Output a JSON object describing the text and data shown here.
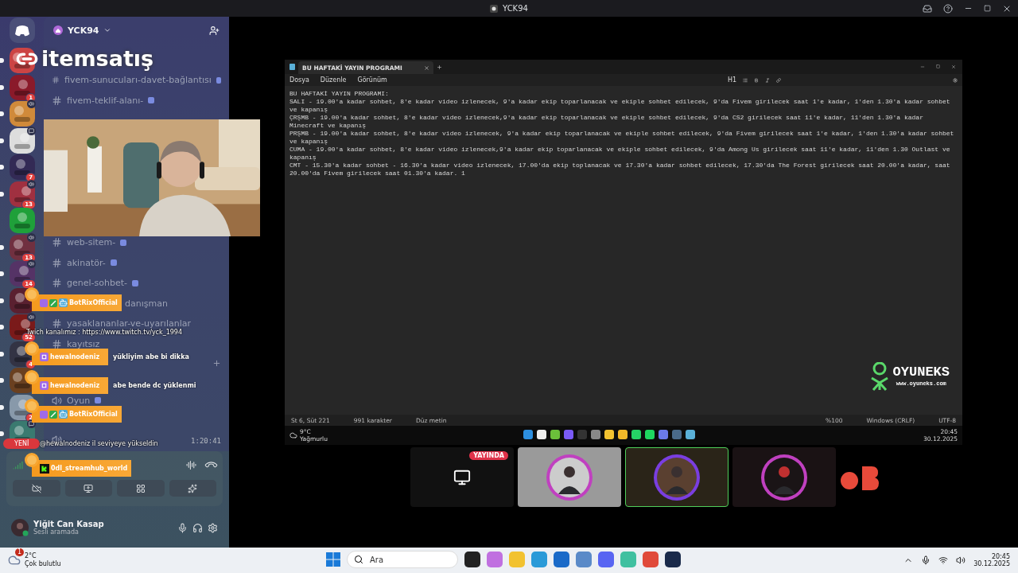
{
  "title_bar": {
    "title": "YCK94"
  },
  "servers": [
    {
      "unread": true,
      "voice": false,
      "chat": false
    },
    {
      "unread": true,
      "voice": false,
      "chat": false,
      "badge": "1"
    },
    {
      "unread": true,
      "voice": true,
      "chat": false
    },
    {
      "unread": true,
      "voice": false,
      "chat": true
    },
    {
      "unread": true,
      "voice": false,
      "chat": false,
      "badge": "7"
    },
    {
      "unread": true,
      "voice": true,
      "chat": false,
      "badge": "13"
    },
    {
      "unread": false,
      "voice": false,
      "chat": false
    },
    {
      "unread": true,
      "voice": true,
      "chat": false,
      "badge": "13"
    },
    {
      "unread": true,
      "voice": true,
      "chat": false,
      "badge": "14"
    },
    {
      "unread": true,
      "voice": false,
      "chat": false
    },
    {
      "unread": true,
      "voice": true,
      "chat": false,
      "badge": "52"
    },
    {
      "unread": true,
      "voice": false,
      "chat": false,
      "badge": "4"
    },
    {
      "unread": true,
      "voice": false,
      "chat": false
    },
    {
      "unread": true,
      "voice": false,
      "chat": false,
      "badge": "2"
    },
    {
      "unread": true,
      "voice": false,
      "chat": true
    }
  ],
  "new_pill": "YENİ",
  "sidebar": {
    "server_name": "YCK94",
    "channels_top": [
      {
        "kind": "text",
        "name": "fivem-sunucuları-davet-bağlantısı",
        "emoji": true
      },
      {
        "kind": "text",
        "name": "fivem-teklif-alanı-",
        "emoji": true
      }
    ],
    "channels": [
      {
        "kind": "text",
        "name": "web-sitem-",
        "emoji": true
      },
      {
        "kind": "text",
        "name": "akinatör-",
        "emoji": true
      },
      {
        "kind": "text",
        "name": "genel-sohbet-",
        "emoji": true
      },
      {
        "kind": "text",
        "name": "danışman",
        "emoji": false
      },
      {
        "kind": "text",
        "name": "yasaklananlar-ve-uyarılanlar",
        "emoji": false
      },
      {
        "kind": "text",
        "name": "kayıtsız",
        "emoji": false
      },
      {
        "kind": "category"
      },
      {
        "kind": "voice",
        "name": "Oyun",
        "emoji": true
      },
      {
        "kind": "voice",
        "timer": "1:20:41"
      }
    ],
    "user": {
      "name": "Yiğit Can Kasap",
      "status": "Sesli aramada"
    }
  },
  "overlay": {
    "logo": "itemsatış",
    "chat": [
      {
        "kind": "bot",
        "user": "BotRixOfficial"
      },
      {
        "kind": "twitch",
        "user": "hewalnodeniz",
        "message": "yükliyim abe bi dikka"
      },
      {
        "kind": "twitch",
        "user": "hewalnodeniz",
        "message": "abe bende dc yüklenmi"
      },
      {
        "kind": "bot",
        "user": "BotRixOfficial"
      },
      {
        "kind": "kick",
        "user": "0dl_streamhub_world"
      }
    ],
    "notices": [
      "Twich kanalımız : https://www.twitch.tv/yck_1994",
      "@hewalnodeniz il seviyeye yükseldin"
    ]
  },
  "notepad": {
    "tab": "BU HAFTAKİ YAYIN PROGRAMI",
    "menu": [
      "Dosya",
      "Düzenle",
      "Görünüm"
    ],
    "heading": "H1",
    "lines": [
      "BU HAFTAKİ YAYIN PROGRAMI:",
      "SALI - 19.00'a kadar sohbet, 8'e kadar video izlenecek, 9'a kadar ekip toparlanacak ve ekiple sohbet edilecek, 9'da Fivem girilecek saat 1'e kadar, 1'den 1.30'a kadar sohbet ve kapanış",
      "ÇRŞMB - 19.00'a kadar sohbet, 8'e kadar video izlenecek,9'a kadar ekip toparlanacak ve ekiple sohbet edilecek, 9'da CS2 girilecek saat 11'e kadar, 11'den 1.30'a kadar Minecraft ve kapanış",
      "PRŞMB - 19.00'a kadar sohbet, 8'e kadar video izlenecek, 9'a kadar ekip toparlanacak ve ekiple sohbet edilecek, 9'da Fivem girilecek saat 1'e kadar, 1'den 1.30'a kadar sohbet ve kapanış",
      "CUMA - 19.00'a kadar sohbet, 8'e kadar video izlenecek,9'a kadar ekip toparlanacak ve ekiple sohbet edilecek, 9'da Among Us girilecek saat 11'e kadar, 11'den 1.30 Outlast ve kapanış",
      "CMT - 15.30'a kadar sohbet - 16.30'a kadar video izlenecek, 17.00'da ekip toplanacak ve 17.30'a kadar sohbet edilecek, 17.30'da The Forest girilecek saat 20.00'a kadar, saat 20.00'da Fivem girilecek saat 01.30'a kadar. 1"
    ],
    "status_left": [
      "St 6, Süt 221",
      "991 karakter",
      "Düz metin"
    ],
    "status_right": [
      "%100",
      "Windows (CRLF)",
      "UTF-8"
    ],
    "sponsor": {
      "name": "OYUNEKS",
      "url": "www.oyuneks.com"
    }
  },
  "stream_taskbar": {
    "temp": "9°C",
    "condition": "Yağmurlu",
    "time": "20:45",
    "date": "30.12.2025"
  },
  "tiles": [
    {
      "kind": "screen",
      "badge": "YAYINDA",
      "speaking": false
    },
    {
      "kind": "avatar",
      "speaking": false
    },
    {
      "kind": "avatar",
      "speaking": true
    },
    {
      "kind": "avatar",
      "speaking": false
    }
  ],
  "taskbar": {
    "alert": "1",
    "temp": "2°C",
    "condition": "Çok bulutlu",
    "search": {
      "placeholder": "Ara"
    },
    "time": "20:45",
    "date": "30.12.2025"
  }
}
